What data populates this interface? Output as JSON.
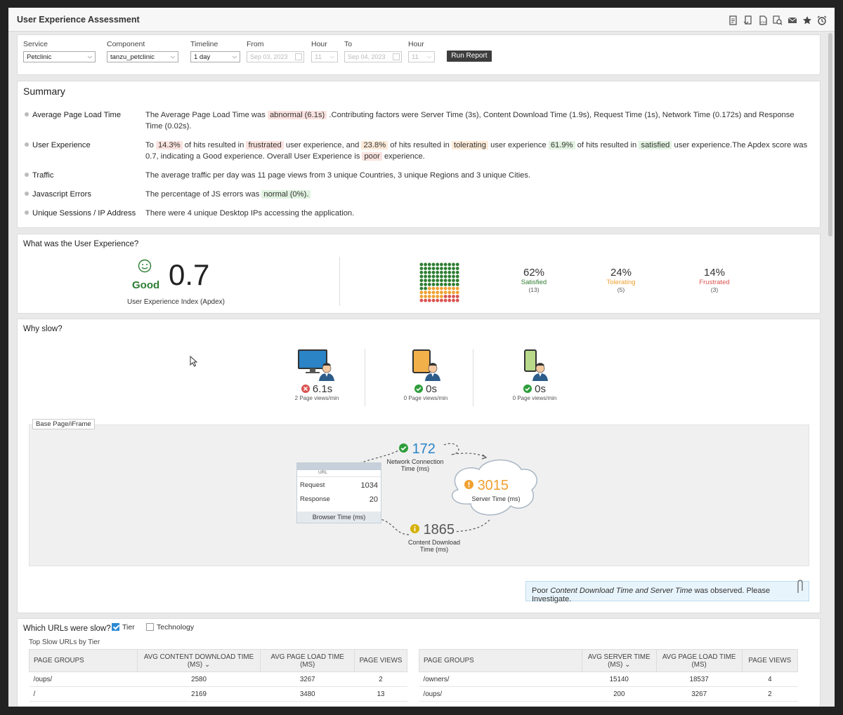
{
  "app": {
    "title": "User Experience Assessment"
  },
  "toolbar_icons": [
    "report-icon",
    "export-icon",
    "pdf-icon",
    "search-report-icon",
    "email-icon",
    "favorite-icon",
    "alarm-icon"
  ],
  "filters": {
    "service_label": "Service",
    "service_value": "Petclinic",
    "component_label": "Component",
    "component_value": "tanzu_petclinic",
    "timeline_label": "Timeline",
    "timeline_value": "1 day",
    "from_label": "From",
    "from_value": "Sep 03, 2023",
    "hour1_label": "Hour",
    "hour1_value": "11",
    "to_label": "To",
    "to_value": "Sep 04, 2023",
    "hour2_label": "Hour",
    "hour2_value": "11",
    "run_label": "Run Report"
  },
  "summary": {
    "title": "Summary",
    "apl_label": "Average Page Load Time",
    "apl_t1": "The Average Page Load Time was ",
    "apl_h1": "abnormal (6.1s)",
    "apl_t2": " .Contributing factors were Server Time (3s), Content Download Time (1.9s), Request Time (1s), Network Time (0.172s) and Response Time (0.02s).",
    "ux_label": "User Experience",
    "ux_t1": "To ",
    "ux_h1": "14.3%",
    "ux_t2": " of hits resulted in ",
    "ux_h2": "frustrated",
    "ux_t3": " user experience, and ",
    "ux_h3": "23.8%",
    "ux_t4": " of hits resulted in ",
    "ux_h4": "tolerating",
    "ux_t5": " user experience ",
    "ux_h5": "61.9%",
    "ux_t6": " of hits resulted in ",
    "ux_h6": "satisfied",
    "ux_t7": " user experience.The Apdex score was 0.7, indicating a Good experience. Overall User Experience is ",
    "ux_h7": "poor",
    "ux_t8": " experience.",
    "traffic_label": "Traffic",
    "traffic_text": "The average traffic per day was 11 page views from 3 unique Countries, 3 unique Regions and 3 unique Cities.",
    "js_label": "Javascript Errors",
    "js_t1": "The percentage of JS errors was ",
    "js_h1": "normal (0%).",
    "sessions_label": "Unique Sessions / IP Address",
    "sessions_text": "There were 4 unique Desktop IPs accessing the application."
  },
  "ux_section": {
    "title": "What was the User Experience?",
    "rating": "Good",
    "apdex": "0.7",
    "apdex_label": "User Experience Index (Apdex)",
    "satisfied_pct": "62%",
    "satisfied_label": "Satisfied",
    "satisfied_count": "(13)",
    "tolerating_pct": "24%",
    "tolerating_label": "Tolerating",
    "tolerating_count": "(5)",
    "frustrated_pct": "14%",
    "frustrated_label": "Frustrated",
    "frustrated_count": "(3)",
    "grid": {
      "green_cells": 62,
      "orange_cells": 24,
      "red_cells": 14
    },
    "colors": {
      "good": "#2e7d32",
      "satisfied": "#2e7d32",
      "tolerating": "#f0a030",
      "frustrated": "#d9534f"
    }
  },
  "why_slow": {
    "title": "Why slow?",
    "desktop_value": "6.1s",
    "desktop_sub": "2 Page views/min",
    "tablet_value": "0s",
    "tablet_sub": "0 Page views/min",
    "mobile_value": "0s",
    "mobile_sub": "0 Page views/min",
    "tab_label": "Base Page/iFrame",
    "network_value": "172",
    "network_label1": "Network Connection",
    "network_label2": "Time (ms)",
    "server_value": "3015",
    "server_label": "Server Time (ms)",
    "content_value": "1865",
    "content_label1": "Content Download",
    "content_label2": "Time (ms)",
    "url_label": "URL",
    "request_label": "Request",
    "request_value": "1034",
    "response_label": "Response",
    "response_value": "20",
    "browser_label": "Browser Time (ms)",
    "investigate_t1": "Poor ",
    "investigate_em": "Content Download Time and Server Time",
    "investigate_t2": " was observed. Please Investigate."
  },
  "urls": {
    "title": "Which URLs were slow?",
    "tier_label": "Tier",
    "technology_label": "Technology",
    "subtitle": "Top Slow URLs by Tier",
    "left_headers": [
      "PAGE GROUPS",
      "AVG CONTENT DOWNLOAD TIME (MS)",
      "AVG PAGE LOAD TIME (MS)",
      "PAGE VIEWS"
    ],
    "left_rows": [
      [
        "/oups/",
        "2580",
        "3267",
        "2"
      ],
      [
        "/",
        "2169",
        "3480",
        "13"
      ]
    ],
    "right_headers": [
      "PAGE GROUPS",
      "AVG SERVER TIME (MS)",
      "AVG PAGE LOAD TIME (MS)",
      "PAGE VIEWS"
    ],
    "right_rows": [
      [
        "/owners/",
        "15140",
        "18537",
        "4"
      ],
      [
        "/oups/",
        "200",
        "3267",
        "2"
      ]
    ]
  }
}
